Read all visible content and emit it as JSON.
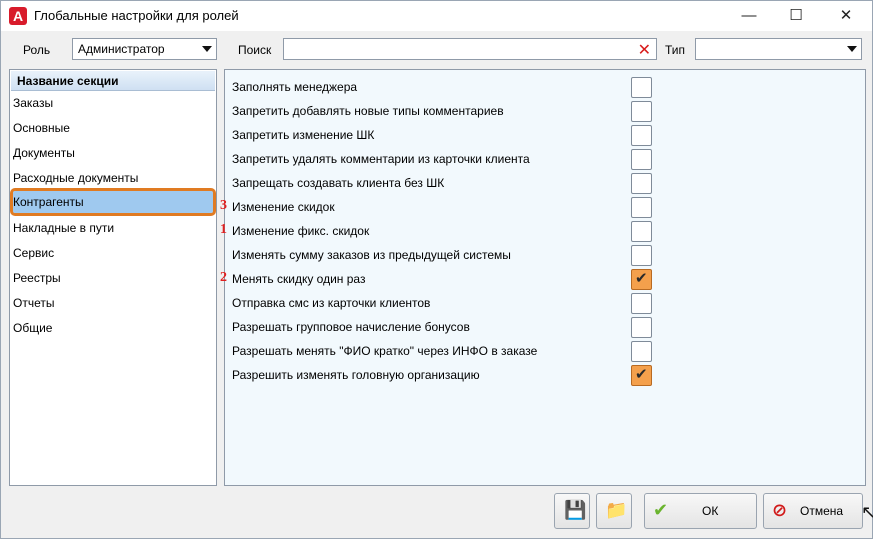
{
  "window": {
    "title": "Глобальные настройки для ролей"
  },
  "toolbar": {
    "role_label": "Роль",
    "role_value": "Администратор",
    "search_label": "Поиск",
    "search_value": "",
    "type_label": "Тип",
    "type_value": ""
  },
  "sections": {
    "header": "Название секции",
    "items": [
      "Заказы",
      "Основные",
      "Документы",
      "Расходные документы",
      "Контрагенты",
      "Накладные в пути",
      "Сервис",
      "Реестры",
      "Отчеты",
      "Общие"
    ],
    "selected": "Контрагенты"
  },
  "options": [
    {
      "label": "Заполнять менеджера",
      "checked": false,
      "marker": ""
    },
    {
      "label": "Запретить добавлять новые типы комментариев",
      "checked": false,
      "marker": ""
    },
    {
      "label": "Запретить изменение ШК",
      "checked": false,
      "marker": ""
    },
    {
      "label": "Запретить удалять комментарии из карточки клиента",
      "checked": false,
      "marker": ""
    },
    {
      "label": "Запрещать создавать клиента без ШК",
      "checked": false,
      "marker": ""
    },
    {
      "label": "Изменение скидок",
      "checked": false,
      "marker": "3"
    },
    {
      "label": "Изменение фикс. скидок",
      "checked": false,
      "marker": "1"
    },
    {
      "label": "Изменять сумму заказов из предыдущей системы",
      "checked": false,
      "marker": ""
    },
    {
      "label": "Менять скидку один раз",
      "checked": true,
      "marker": "2"
    },
    {
      "label": "Отправка смс из карточки клиентов",
      "checked": false,
      "marker": ""
    },
    {
      "label": "Разрешать групповое начисление бонусов",
      "checked": false,
      "marker": ""
    },
    {
      "label": "Разрешать менять \"ФИО кратко\" через ИНФО в заказе",
      "checked": false,
      "marker": ""
    },
    {
      "label": "Разрешить изменять головную организацию",
      "checked": true,
      "marker": ""
    }
  ],
  "buttons": {
    "ok_label": "ОК",
    "cancel_label": "Отмена"
  },
  "colors": {
    "selection": "#9fc9ef",
    "highlight_outline": "#e07b22",
    "checked_box": "#f4a04c",
    "marker": "#e02020"
  }
}
